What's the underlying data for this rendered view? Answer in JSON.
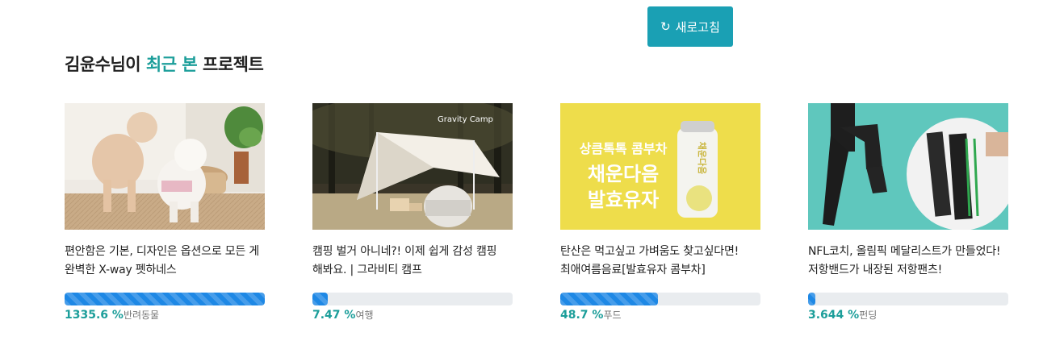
{
  "refresh": {
    "icon": "refresh-icon",
    "label": "새로고침"
  },
  "section": {
    "prefix": "김윤수님이 ",
    "highlight": "최근 본",
    "suffix": " 프로젝트"
  },
  "colors": {
    "accent": "#1aa0b4",
    "highlight": "#1c9e9a",
    "progress": "#1e88e5"
  },
  "projects": [
    {
      "title": "편안함은 기본, 디자인은 옵션으로 모든 게 완벽한 X-way 펫하네스",
      "percent_label": "1335.6 %",
      "percent": 1335.6,
      "category": "반려동물"
    },
    {
      "title": "캠핑 벌거 아니네?! 이제 쉽게 감성 캠핑 해봐요. | 그라비티 캠프",
      "percent_label": "7.47 %",
      "percent": 7.47,
      "category": "여행",
      "brand": "Gravity Camp"
    },
    {
      "title": "탄산은 먹고싶고 가벼움도 찾고싶다면! 최애여름음료[발효유자 콤부차]",
      "percent_label": "48.7 %",
      "percent": 48.7,
      "category": "푸드",
      "img_text": {
        "line1": "상큼톡톡 콤부차",
        "line2": "채운다음",
        "line3": "발효유자",
        "can": "채운다음"
      }
    },
    {
      "title": "NFL코치, 올림픽 메달리스트가 만들었다! 저항밴드가 내장된 저항팬츠!",
      "percent_label": "3.644 %",
      "percent": 3.644,
      "category": "펀딩"
    }
  ]
}
